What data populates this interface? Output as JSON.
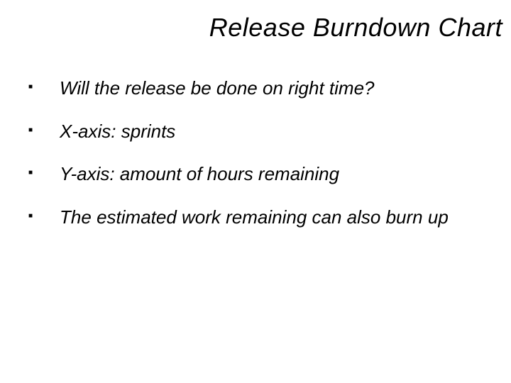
{
  "title": "Release Burndown Chart",
  "bullets": [
    {
      "text": "Will the release be done on right time?"
    },
    {
      "text": "X-axis: sprints"
    },
    {
      "text": "Y-axis: amount of hours remaining"
    },
    {
      "text": "The estimated work remaining can also burn up"
    }
  ]
}
